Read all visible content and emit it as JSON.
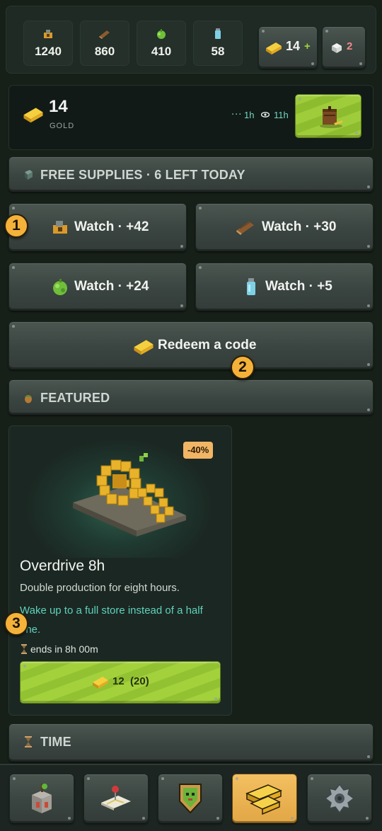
{
  "resources": [
    {
      "name": "gears",
      "icon": "gear-resource-icon",
      "value": "1240"
    },
    {
      "name": "wood",
      "icon": "wood-log-icon",
      "value": "860"
    },
    {
      "name": "plants",
      "icon": "plant-bush-icon",
      "value": "410"
    },
    {
      "name": "water",
      "icon": "water-bottle-icon",
      "value": "58"
    }
  ],
  "gold_pill": {
    "value": "14",
    "plus": "+"
  },
  "gem_pill": {
    "value": "2"
  },
  "gold_info": {
    "amount": "14",
    "caption": "GOLD",
    "timer_short": "1h",
    "timer_long": "11h"
  },
  "free_supplies": {
    "header": "FREE SUPPLIES · 6 LEFT TODAY"
  },
  "watch_buttons": [
    {
      "label": "Watch · +42",
      "icon": "gear-resource-icon"
    },
    {
      "label": "Watch · +30",
      "icon": "wood-log-icon"
    },
    {
      "label": "Watch · +24",
      "icon": "plant-bush-icon"
    },
    {
      "label": "Watch · +5",
      "icon": "water-bottle-icon"
    }
  ],
  "redeem": {
    "label": "Redeem a code"
  },
  "badges": [
    "1",
    "2",
    "3"
  ],
  "featured": {
    "header": "FEATURED",
    "discount": "-40%",
    "title": "Overdrive 8h",
    "description": "Double production for eight hours.",
    "bonus": "Wake up to a full store instead of a half one.",
    "ends": "ends in 8h 00m",
    "price_label": "12  (20)"
  },
  "time_section": {
    "header": "TIME"
  },
  "nav": [
    {
      "name": "tower",
      "icon": "tower-icon",
      "active": false
    },
    {
      "name": "map",
      "icon": "map-pin-icon",
      "active": false
    },
    {
      "name": "shield",
      "icon": "shield-icon",
      "active": false
    },
    {
      "name": "shop",
      "icon": "gold-bars-icon",
      "active": true
    },
    {
      "name": "settings",
      "icon": "settings-icon",
      "active": false
    }
  ],
  "colors": {
    "accent_green": "#9fcc3a",
    "accent_gold": "#f4b23a",
    "teal_text": "#5fd2bd",
    "panel_dark": "#111a17"
  }
}
